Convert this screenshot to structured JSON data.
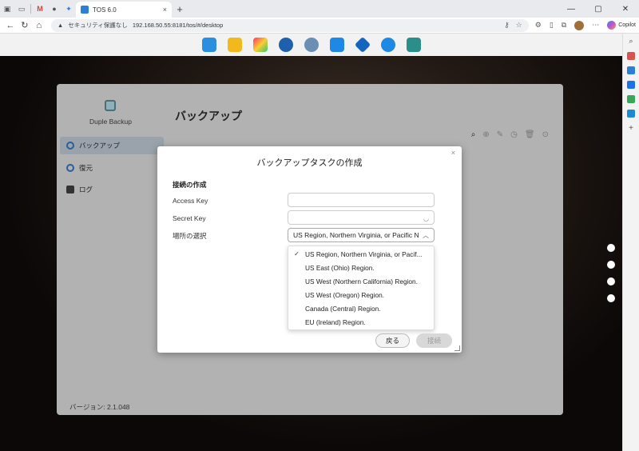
{
  "browser": {
    "tab_title": "TOS 6.0",
    "new_tab": "+",
    "url_warning": "セキュリティ保護なし",
    "url": "192.168.50.55:8181/tos/#/desktop",
    "copilot_label": "Copilot"
  },
  "app": {
    "name": "Duple Backup",
    "page_title": "バックアップ",
    "version": "バージョン: 2.1.048",
    "sidebar": [
      {
        "label": "バックアップ",
        "icon": "backup-icon",
        "active": true
      },
      {
        "label": "復元",
        "icon": "restore-icon",
        "active": false
      },
      {
        "label": "ログ",
        "icon": "log-icon",
        "active": false
      }
    ]
  },
  "modal": {
    "title": "バックアップタスクの作成",
    "close": "×",
    "section_title": "接続の作成",
    "access_key_label": "Access Key",
    "access_key_value": "",
    "secret_key_label": "Secret Key",
    "secret_key_value": "",
    "location_label": "場所の選択",
    "location_selected": "US Region, Northern Virginia, or Pacific Northwest",
    "options": [
      {
        "label": "US Region, Northern Virginia, or Pacif...",
        "checked": true
      },
      {
        "label": "US East (Ohio) Region.",
        "checked": false
      },
      {
        "label": "US West (Northern California) Region.",
        "checked": false
      },
      {
        "label": "US West (Oregon) Region.",
        "checked": false
      },
      {
        "label": "Canada (Central) Region.",
        "checked": false
      },
      {
        "label": "EU (Ireland) Region.",
        "checked": false
      }
    ],
    "back_button": "戻る",
    "connect_button": "接続"
  },
  "colors": {
    "accent": "#2b7fd4",
    "window_bg": "#b2b2b2",
    "sidebar_active": "#9aa3ab"
  }
}
